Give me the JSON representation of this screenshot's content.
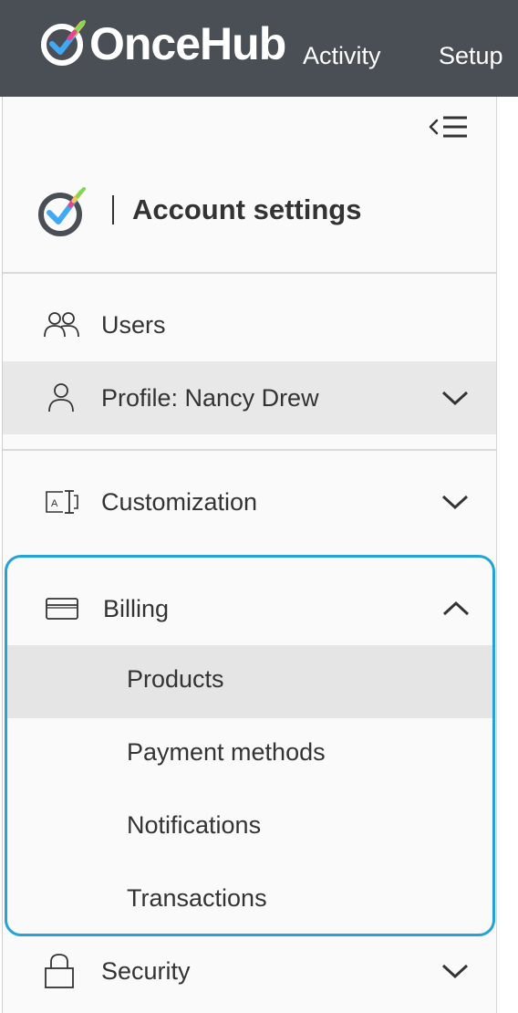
{
  "topbar": {
    "brand": "OnceHub",
    "nav": [
      "Activity",
      "Setup"
    ],
    "bg_color": "#4a4f55"
  },
  "sidebar": {
    "collapse_icon": "collapse-menu-icon",
    "header_title": "Account settings",
    "items": [
      {
        "label": "Users",
        "icon": "users-icon"
      },
      {
        "label": "Profile: Nancy Drew",
        "icon": "user-icon"
      },
      {
        "label": "Customization",
        "icon": "customization-icon"
      },
      {
        "label": "Billing",
        "icon": "credit-card-icon"
      },
      {
        "label": "Security",
        "icon": "lock-icon"
      }
    ],
    "billing_submenu": [
      "Products",
      "Payment methods",
      "Notifications",
      "Transactions"
    ],
    "active_submenu": "Products",
    "highlight_color": "#23a3d8"
  }
}
